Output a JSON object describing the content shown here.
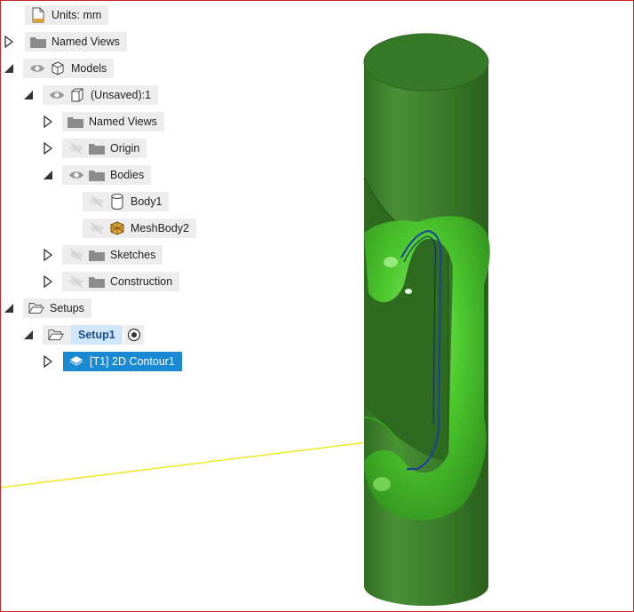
{
  "browser": {
    "units_label": "Units: mm",
    "named_views_label": "Named Views",
    "models_label": "Models",
    "component_label": "(Unsaved):1",
    "component_named_views_label": "Named Views",
    "origin_label": "Origin",
    "bodies_label": "Bodies",
    "body1_label": "Body1",
    "meshbody2_label": "MeshBody2",
    "sketches_label": "Sketches",
    "construction_label": "Construction",
    "setups_label": "Setups",
    "setup1_label": "Setup1",
    "operation_label": "[T1] 2D Contour1"
  },
  "colors": {
    "selection_blue": "#1a8ad4",
    "setup_highlight": "#cfe6fb",
    "model_green": "#3a8a2a",
    "mesh_green": "#4ec82e",
    "frame_red": "#c62828",
    "axis_yellow": "#f2e600"
  },
  "icons": {
    "units": "document-ruler-icon",
    "folder": "folder-icon",
    "eye": "eye-icon",
    "eye_hidden": "eye-hidden-icon",
    "component": "component-box-icon",
    "body": "cylinder-body-icon",
    "mesh": "mesh-body-icon",
    "setup": "open-folder-setup-icon",
    "toolpath": "toolpath-op-icon",
    "radio": "radio-target-icon"
  }
}
